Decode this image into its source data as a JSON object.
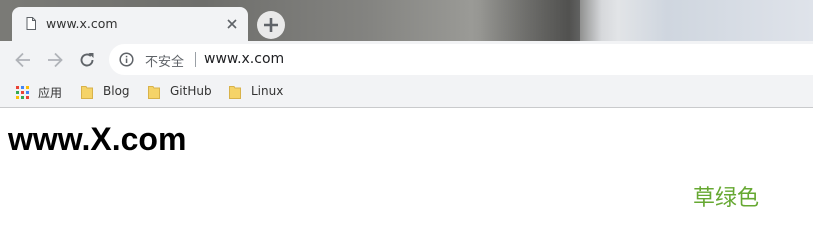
{
  "tab": {
    "title": "www.x.com"
  },
  "toolbar": {
    "security_label": "不安全",
    "url": "www.x.com"
  },
  "bookmarks": {
    "items": [
      {
        "label": "应用",
        "icon": "apps-grid-icon"
      },
      {
        "label": "Blog",
        "icon": "folder-icon"
      },
      {
        "label": "GitHub",
        "icon": "folder-icon"
      },
      {
        "label": "Linux",
        "icon": "folder-icon"
      }
    ]
  },
  "page": {
    "heading": "www.X.com",
    "green_text": "草绿色",
    "green_color": "#66a832"
  },
  "colors": {
    "chrome_bg": "#f2f3f5",
    "folder_yellow": "#f5d368"
  }
}
